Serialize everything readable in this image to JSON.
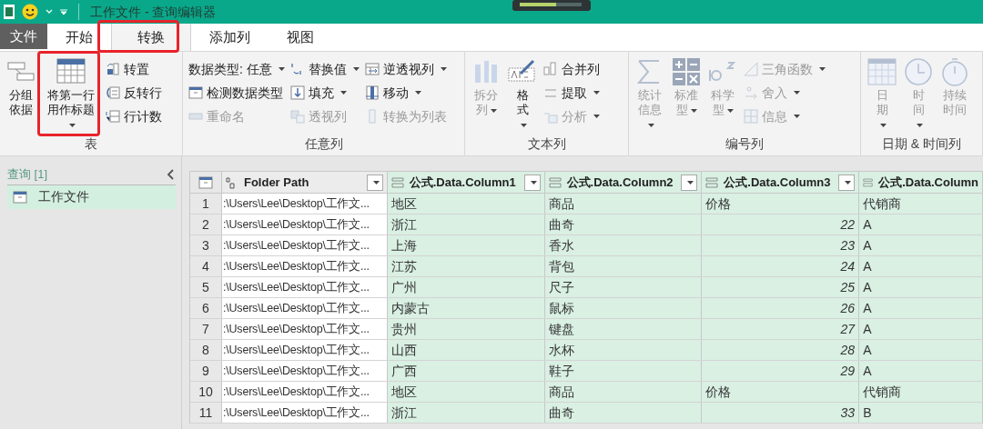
{
  "title_bar": {
    "title": "工作文件 - 查询编辑器"
  },
  "tabs": [
    {
      "label": "文件",
      "kind": "file",
      "selected": false
    },
    {
      "label": "开始",
      "kind": "normal",
      "selected": false
    },
    {
      "label": "转换",
      "kind": "normal",
      "selected": true
    },
    {
      "label": "添加列",
      "kind": "normal",
      "selected": false
    },
    {
      "label": "视图",
      "kind": "normal",
      "selected": false
    }
  ],
  "ribbon": {
    "groups": [
      {
        "label": "表",
        "items": [
          {
            "label": "分组依据",
            "kind": "large",
            "disabled": false,
            "dropdown": false
          },
          {
            "label": "将第一行用作标题",
            "kind": "large",
            "disabled": false,
            "dropdown": true
          },
          {
            "label": "转置",
            "kind": "small",
            "disabled": false,
            "dropdown": false
          },
          {
            "label": "反转行",
            "kind": "small",
            "disabled": false,
            "dropdown": false
          },
          {
            "label": "行计数",
            "kind": "small",
            "disabled": false,
            "dropdown": false
          }
        ]
      },
      {
        "label": "任意列",
        "items": [
          {
            "label": "数据类型: 任意",
            "kind": "small",
            "disabled": false,
            "dropdown": true
          },
          {
            "label": "检测数据类型",
            "kind": "small",
            "disabled": false,
            "dropdown": false
          },
          {
            "label": "重命名",
            "kind": "small",
            "disabled": true,
            "dropdown": false
          },
          {
            "label": "替换值",
            "kind": "small",
            "disabled": false,
            "dropdown": true
          },
          {
            "label": "填充",
            "kind": "small",
            "disabled": false,
            "dropdown": true
          },
          {
            "label": "透视列",
            "kind": "small",
            "disabled": true,
            "dropdown": false
          },
          {
            "label": "逆透视列",
            "kind": "small",
            "disabled": false,
            "dropdown": true
          },
          {
            "label": "移动",
            "kind": "small",
            "disabled": false,
            "dropdown": true
          },
          {
            "label": "转换为列表",
            "kind": "small",
            "disabled": true,
            "dropdown": false
          }
        ]
      },
      {
        "label": "文本列",
        "items": [
          {
            "label": "拆分列",
            "kind": "large",
            "disabled": true,
            "dropdown": true
          },
          {
            "label": "格式",
            "kind": "large",
            "disabled": false,
            "dropdown": true
          },
          {
            "label": "合并列",
            "kind": "small",
            "disabled": false,
            "dropdown": false
          },
          {
            "label": "提取",
            "kind": "small",
            "disabled": false,
            "dropdown": true
          },
          {
            "label": "分析",
            "kind": "small",
            "disabled": true,
            "dropdown": true
          }
        ]
      },
      {
        "label": "编号列",
        "items": [
          {
            "label": "统计信息",
            "kind": "large",
            "disabled": true,
            "dropdown": true
          },
          {
            "label": "标准型",
            "kind": "large",
            "disabled": true,
            "dropdown": true
          },
          {
            "label": "科学型",
            "kind": "large",
            "disabled": true,
            "dropdown": true
          },
          {
            "label": "三角函数",
            "kind": "small",
            "disabled": true,
            "dropdown": true
          },
          {
            "label": "舍入",
            "kind": "small",
            "disabled": true,
            "dropdown": true
          },
          {
            "label": "信息",
            "kind": "small",
            "disabled": true,
            "dropdown": true
          }
        ]
      },
      {
        "label": "日期 & 时间列",
        "items": [
          {
            "label": "日期",
            "kind": "large",
            "disabled": true,
            "dropdown": true
          },
          {
            "label": "时间",
            "kind": "large",
            "disabled": true,
            "dropdown": true
          },
          {
            "label": "持续时间",
            "kind": "large",
            "disabled": true,
            "dropdown": false
          }
        ]
      }
    ]
  },
  "queries": {
    "title": "查询 [1]",
    "items": [
      {
        "label": "工作文件",
        "selected": true
      }
    ]
  },
  "table": {
    "columns": [
      "Folder Path",
      "公式.Data.Column1",
      "公式.Data.Column2",
      "公式.Data.Column3",
      "公式.Data.Column"
    ],
    "rows": [
      {
        "index": "1",
        "cells": [
          ":\\Users\\Lee\\Desktop\\工作文...",
          "地区",
          "商品",
          "价格",
          "代销商"
        ],
        "price_is_number": false
      },
      {
        "index": "2",
        "cells": [
          ":\\Users\\Lee\\Desktop\\工作文...",
          "浙江",
          "曲奇",
          "22",
          "A"
        ],
        "price_is_number": true
      },
      {
        "index": "3",
        "cells": [
          ":\\Users\\Lee\\Desktop\\工作文...",
          "上海",
          "香水",
          "23",
          "A"
        ],
        "price_is_number": true
      },
      {
        "index": "4",
        "cells": [
          ":\\Users\\Lee\\Desktop\\工作文...",
          "江苏",
          "背包",
          "24",
          "A"
        ],
        "price_is_number": true
      },
      {
        "index": "5",
        "cells": [
          ":\\Users\\Lee\\Desktop\\工作文...",
          "广州",
          "尺子",
          "25",
          "A"
        ],
        "price_is_number": true
      },
      {
        "index": "6",
        "cells": [
          ":\\Users\\Lee\\Desktop\\工作文...",
          "内蒙古",
          "鼠标",
          "26",
          "A"
        ],
        "price_is_number": true
      },
      {
        "index": "7",
        "cells": [
          ":\\Users\\Lee\\Desktop\\工作文...",
          "贵州",
          "键盘",
          "27",
          "A"
        ],
        "price_is_number": true
      },
      {
        "index": "8",
        "cells": [
          ":\\Users\\Lee\\Desktop\\工作文...",
          "山西",
          "水杯",
          "28",
          "A"
        ],
        "price_is_number": true
      },
      {
        "index": "9",
        "cells": [
          ":\\Users\\Lee\\Desktop\\工作文...",
          "广西",
          "鞋子",
          "29",
          "A"
        ],
        "price_is_number": true
      },
      {
        "index": "10",
        "cells": [
          ":\\Users\\Lee\\Desktop\\工作文...",
          "地区",
          "商品",
          "价格",
          "代销商"
        ],
        "price_is_number": false
      },
      {
        "index": "11",
        "cells": [
          ":\\Users\\Lee\\Desktop\\工作文...",
          "浙江",
          "曲奇",
          "33",
          "B"
        ],
        "price_is_number": true
      }
    ]
  }
}
